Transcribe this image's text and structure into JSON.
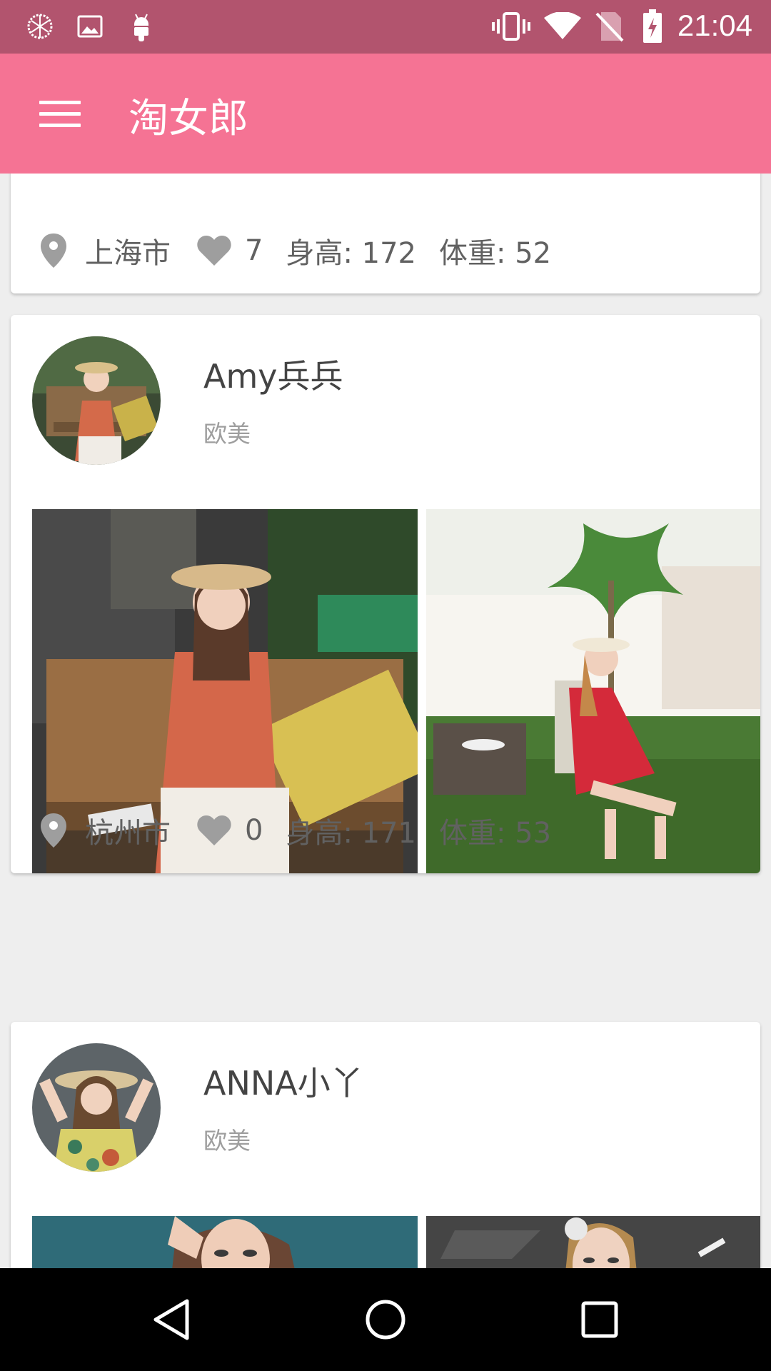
{
  "status_bar": {
    "time": "21:04",
    "left_icons": [
      "clover-app-icon",
      "image-icon",
      "android-icon"
    ],
    "right_icons": [
      "vibrate-icon",
      "wifi-icon",
      "no-sim-icon",
      "battery-charging-icon"
    ]
  },
  "app_bar": {
    "title": "淘女郎",
    "menu_icon": "hamburger-menu-icon",
    "background": "#f57394"
  },
  "cards": [
    {
      "location": "上海市",
      "likes": "7",
      "height": "身高: 172",
      "weight": "体重: 52"
    },
    {
      "name": "Amy兵兵",
      "category": "欧美",
      "location": "杭州市",
      "likes": "0",
      "height": "身高: 171",
      "weight": "体重: 53"
    },
    {
      "name": "ANNA小丫",
      "category": "欧美"
    }
  ],
  "nav_bar": {
    "buttons": [
      "back-icon",
      "home-icon",
      "recents-icon"
    ]
  },
  "colors": {
    "status_bar": "#b2546e",
    "accent": "#f57394"
  }
}
